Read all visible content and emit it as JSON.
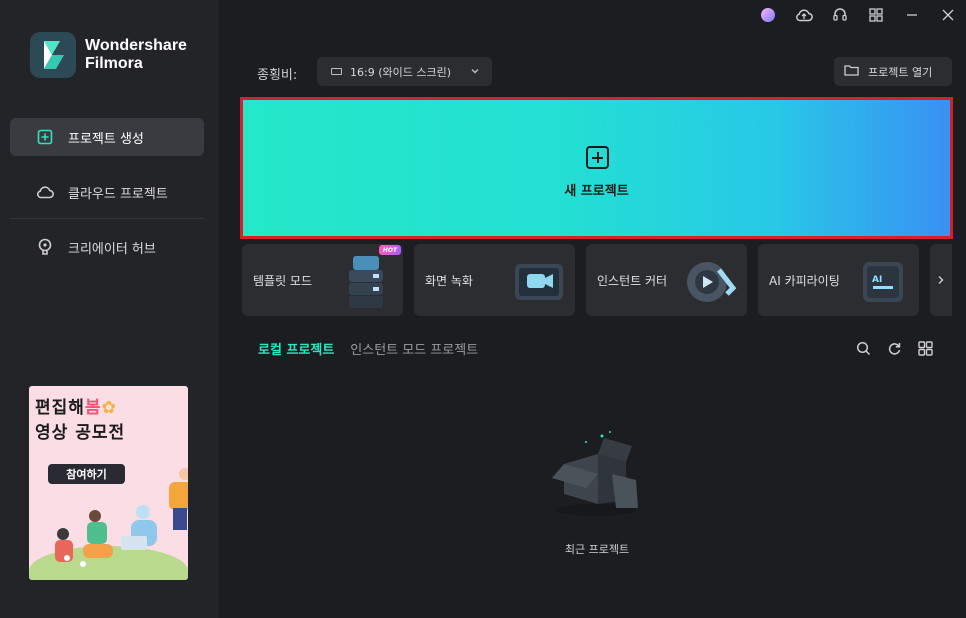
{
  "app": {
    "logo_line1": "Wondershare",
    "logo_line2": "Filmora"
  },
  "sidebar": {
    "items": [
      {
        "label": "프로젝트 생성",
        "icon": "plus-square-icon",
        "active": true
      },
      {
        "label": "클라우드 프로젝트",
        "icon": "cloud-icon",
        "active": false
      },
      {
        "label": "크리에이터 허브",
        "icon": "lightbulb-icon",
        "active": false
      }
    ],
    "banner": {
      "line1": "편집해",
      "highlight": "봄",
      "line2": "영상 공모전",
      "button": "참여하기"
    }
  },
  "window_controls": [
    "avatar-icon",
    "cloud-upload-icon",
    "headset-icon",
    "grid-apps-icon",
    "minimize-icon",
    "close-icon"
  ],
  "toolbar": {
    "aspect_label": "종횡비:",
    "aspect_value": "16:9 (와이드 스크린)",
    "open_project": "프로젝트 열기"
  },
  "new_project": {
    "label": "새 프로젝트",
    "highlight_border": "#d8202b"
  },
  "quick_cards": [
    {
      "label": "템플릿 모드",
      "badge": "HOT"
    },
    {
      "label": "화면 녹화"
    },
    {
      "label": "인스턴트 커터"
    },
    {
      "label": "AI 카피라이팅"
    }
  ],
  "tabs": [
    {
      "label": "로컬 프로젝트",
      "active": true
    },
    {
      "label": "인스턴트 모드 프로젝트",
      "active": false
    }
  ],
  "empty_state": {
    "label": "최근 프로젝트"
  },
  "colors": {
    "accent": "#2ee5c2",
    "background": "#1c1d20",
    "sidebar": "#232428"
  }
}
